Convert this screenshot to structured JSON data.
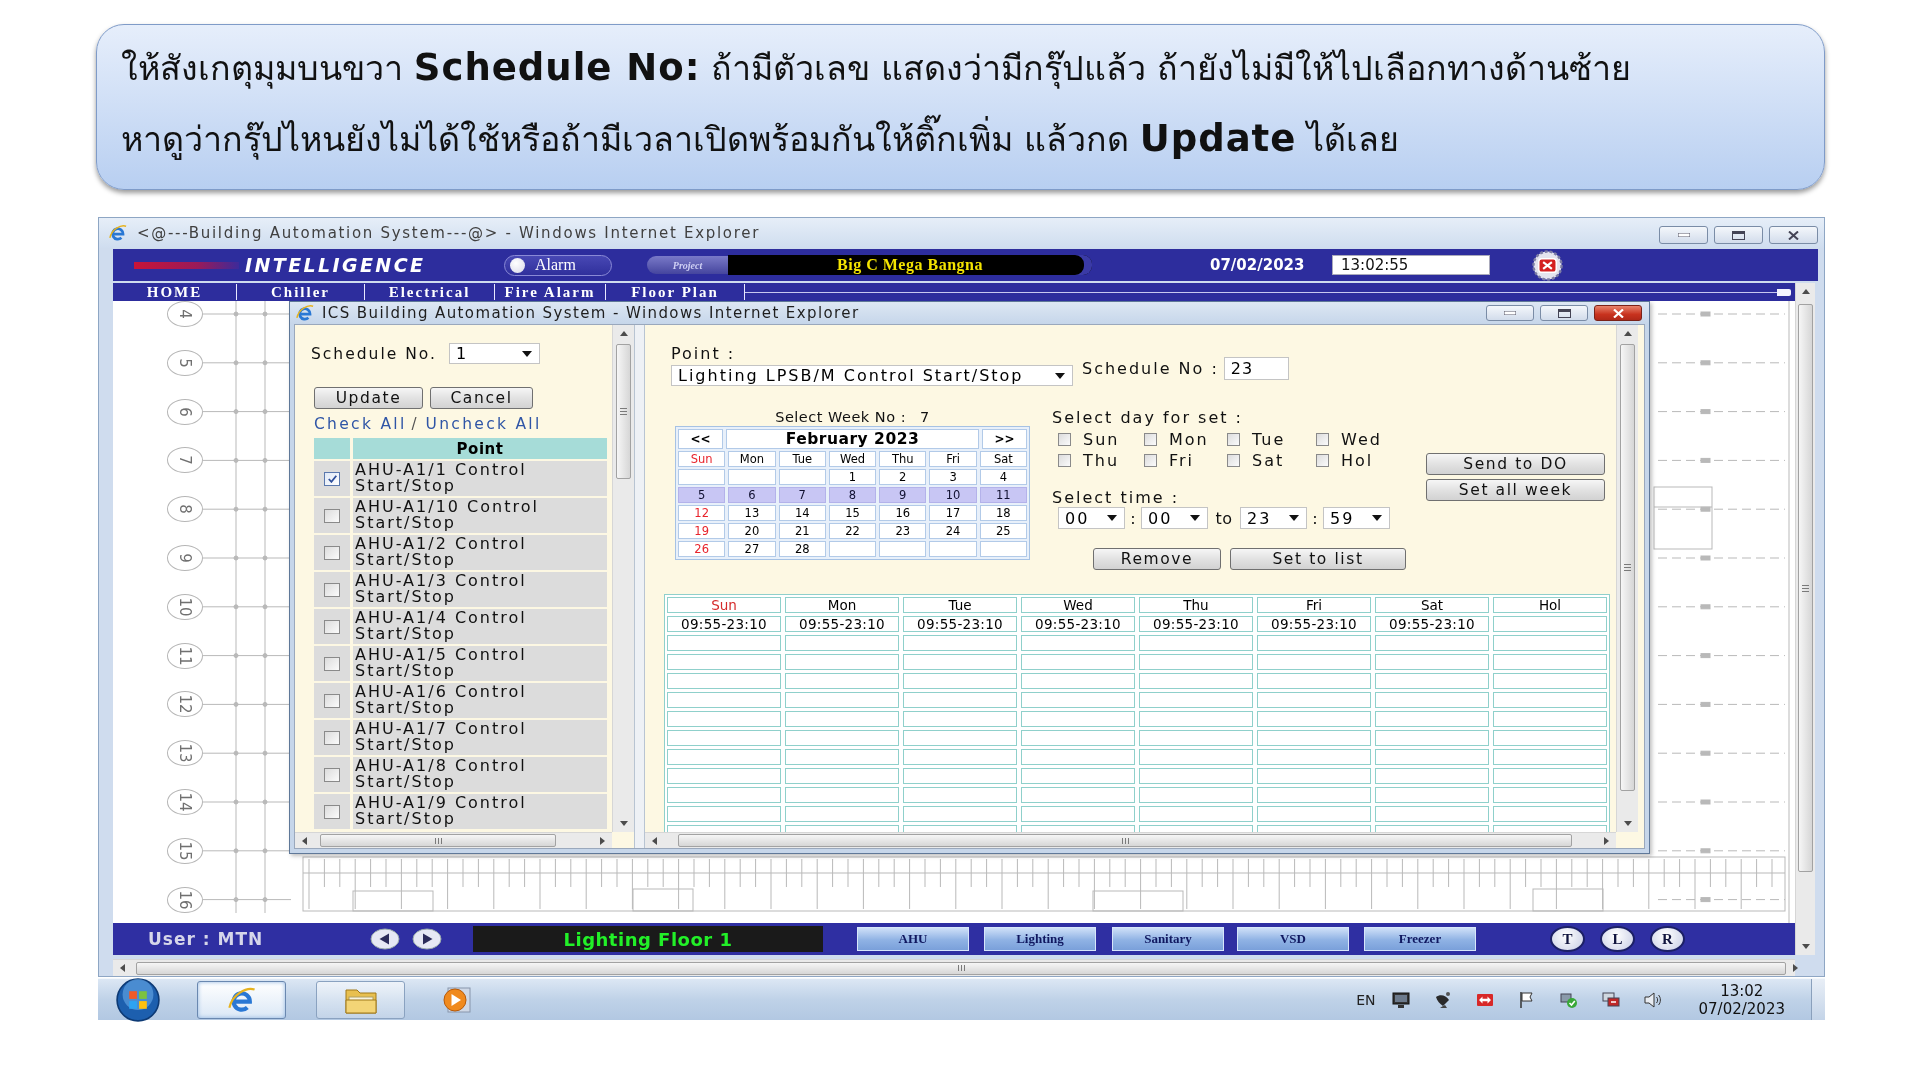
{
  "callout": {
    "lines": [
      "ให้สังเกตุมุมบนขวา **Schedule No:** ถ้ามีตัวเลข แสดงว่ามีกรุ๊ปแล้ว ถ้ายังไม่มีให้ไปเลือกทางด้านซ้าย",
      "หาดูว่ากรุ๊ปไหนยังไม่ได้ใช้หรือถ้ามีเวลาเปิดพร้อมกันให้ติ๊กเพิ่ม แล้วกด **Update** ได้เลย"
    ]
  },
  "browser_window": {
    "title": "<@---Building Automation System---@> - Windows Internet Explorer",
    "header": {
      "brand": "INTELLIGENCE",
      "alarm_button": "Alarm",
      "project_label": "Project",
      "project_name": "Big C Mega Bangna",
      "date": "07/02/2023",
      "time": "13:02:55"
    },
    "menu": [
      "HOME",
      "Chiller",
      "Electrical",
      "Fire Alarm",
      "Floor Plan"
    ],
    "floor_plan": {
      "grid_labels": [
        "4",
        "5",
        "6",
        "7",
        "8",
        "9",
        "10",
        "11",
        "12",
        "13",
        "14",
        "15",
        "16"
      ]
    },
    "footer": {
      "user": "User : MTN",
      "location": "Lighting Floor 1",
      "page_buttons": [
        "AHU",
        "Lighting",
        "Sanitary",
        "VSD",
        "Freezer"
      ],
      "view_buttons": [
        "T",
        "L",
        "R"
      ]
    }
  },
  "dialog": {
    "title": "ICS Building Automation System - Windows Internet Explorer",
    "left_panel": {
      "schedule_label": "Schedule No.",
      "schedule_value": "1",
      "buttons": [
        "Update",
        "Cancel"
      ],
      "check_all": "Check All",
      "link_separator": "/",
      "uncheck_all": "Uncheck All",
      "column": "Point",
      "points": [
        {
          "name": "AHU-A1/1 Control Start/Stop",
          "checked": true
        },
        {
          "name": "AHU-A1/10 Control Start/Stop",
          "checked": false
        },
        {
          "name": "AHU-A1/2 Control Start/Stop",
          "checked": false
        },
        {
          "name": "AHU-A1/3 Control Start/Stop",
          "checked": false
        },
        {
          "name": "AHU-A1/4 Control Start/Stop",
          "checked": false
        },
        {
          "name": "AHU-A1/5 Control Start/Stop",
          "checked": false
        },
        {
          "name": "AHU-A1/6 Control Start/Stop",
          "checked": false
        },
        {
          "name": "AHU-A1/7 Control Start/Stop",
          "checked": false
        },
        {
          "name": "AHU-A1/8 Control Start/Stop",
          "checked": false
        },
        {
          "name": "AHU-A1/9 Control Start/Stop",
          "checked": false
        }
      ]
    },
    "right_panel": {
      "point_label": "Point :",
      "point_value": "Lighting LPSB/M Control Start/Stop",
      "schedule_label": "Schedule No :",
      "schedule_value": "23",
      "week_label": "Select Week No :",
      "week_value": "7",
      "calendar": {
        "prev": "<<",
        "month": "February 2023",
        "next": ">>",
        "weekdays": [
          {
            "label": "Sun",
            "emphasized": true
          },
          {
            "label": "Mon",
            "emphasized": false
          },
          {
            "label": "Tue",
            "emphasized": false
          },
          {
            "label": "Wed",
            "emphasized": false
          },
          {
            "label": "Thu",
            "emphasized": false
          },
          {
            "label": "Fri",
            "emphasized": false
          },
          {
            "label": "Sat",
            "emphasized": false
          }
        ],
        "weeks": [
          {
            "selected": false,
            "days": [
              {
                "kind": "blank"
              },
              {
                "kind": "blank"
              },
              {
                "kind": "blank"
              },
              {
                "kind": "day",
                "label": "1"
              },
              {
                "kind": "day",
                "label": "2"
              },
              {
                "kind": "day",
                "label": "3"
              },
              {
                "kind": "day",
                "label": "4"
              }
            ]
          },
          {
            "selected": true,
            "days": [
              {
                "kind": "day",
                "label": "5"
              },
              {
                "kind": "day",
                "label": "6"
              },
              {
                "kind": "day",
                "label": "7"
              },
              {
                "kind": "day",
                "label": "8"
              },
              {
                "kind": "day",
                "label": "9"
              },
              {
                "kind": "day",
                "label": "10"
              },
              {
                "kind": "day",
                "label": "11"
              }
            ]
          },
          {
            "selected": false,
            "days": [
              {
                "kind": "day",
                "label": "12"
              },
              {
                "kind": "day",
                "label": "13"
              },
              {
                "kind": "day",
                "label": "14"
              },
              {
                "kind": "day",
                "label": "15"
              },
              {
                "kind": "day",
                "label": "16"
              },
              {
                "kind": "day",
                "label": "17"
              },
              {
                "kind": "day",
                "label": "18"
              }
            ]
          },
          {
            "selected": false,
            "days": [
              {
                "kind": "day",
                "label": "19"
              },
              {
                "kind": "day",
                "label": "20"
              },
              {
                "kind": "day",
                "label": "21"
              },
              {
                "kind": "day",
                "label": "22"
              },
              {
                "kind": "day",
                "label": "23"
              },
              {
                "kind": "day",
                "label": "24"
              },
              {
                "kind": "day",
                "label": "25"
              }
            ]
          },
          {
            "selected": false,
            "days": [
              {
                "kind": "day",
                "label": "26"
              },
              {
                "kind": "day",
                "label": "27"
              },
              {
                "kind": "day",
                "label": "28"
              },
              {
                "kind": "blank"
              },
              {
                "kind": "blank"
              },
              {
                "kind": "blank"
              },
              {
                "kind": "blank"
              }
            ]
          }
        ]
      },
      "day_select": {
        "label": "Select day for set :",
        "days": [
          {
            "label": "Sun",
            "checked": false
          },
          {
            "label": "Mon",
            "checked": false
          },
          {
            "label": "Tue",
            "checked": false
          },
          {
            "label": "Wed",
            "checked": false
          },
          {
            "label": "Thu",
            "checked": false
          },
          {
            "label": "Fri",
            "checked": false
          },
          {
            "label": "Sat",
            "checked": false
          },
          {
            "label": "Hol",
            "checked": false
          }
        ]
      },
      "time_select": {
        "label": "Select time :",
        "start_hour": "00",
        "start_separator": ":",
        "start_minute": "00",
        "to_label": "to",
        "end_hour": "23",
        "end_separator": ":",
        "end_minute": "59"
      },
      "actions": [
        "Remove",
        "Set to list"
      ],
      "side_buttons": [
        "Send to DO",
        "Set all week"
      ],
      "schedule_table": {
        "columns": [
          {
            "label": "Sun",
            "emphasized": true
          },
          {
            "label": "Mon",
            "emphasized": false
          },
          {
            "label": "Tue",
            "emphasized": false
          },
          {
            "label": "Wed",
            "emphasized": false
          },
          {
            "label": "Thu",
            "emphasized": false
          },
          {
            "label": "Fri",
            "emphasized": false
          },
          {
            "label": "Sat",
            "emphasized": false
          },
          {
            "label": "Hol",
            "emphasized": false
          }
        ],
        "rows": [
          [
            {
              "kind": "time",
              "text": "09:55-23:10"
            },
            {
              "kind": "time",
              "text": "09:55-23:10"
            },
            {
              "kind": "time",
              "text": "09:55-23:10"
            },
            {
              "kind": "time",
              "text": "09:55-23:10"
            },
            {
              "kind": "time",
              "text": "09:55-23:10"
            },
            {
              "kind": "time",
              "text": "09:55-23:10"
            },
            {
              "kind": "time",
              "text": "09:55-23:10"
            },
            {
              "kind": "blank"
            }
          ]
        ]
      }
    }
  },
  "taskbar": {
    "apps": [
      {
        "kind": "browser",
        "running": true,
        "selected": true
      },
      {
        "kind": "folder",
        "running": true,
        "selected": false
      },
      {
        "kind": "media",
        "running": false,
        "selected": false
      }
    ],
    "language": "EN",
    "time": "13:02",
    "date": "07/02/2023"
  }
}
